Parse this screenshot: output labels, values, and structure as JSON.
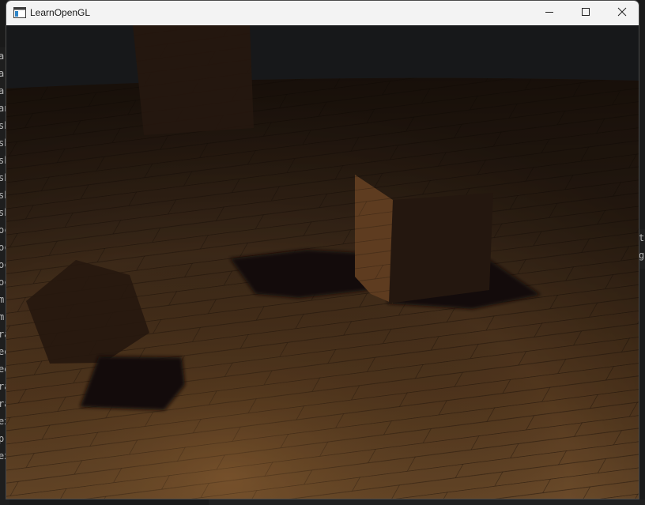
{
  "window": {
    "title": "LearnOpenGL",
    "icon": "app-window-icon",
    "controls": {
      "minimize": "minimize-icon",
      "maximize": "maximize-icon",
      "close": "close-icon"
    }
  },
  "scene": {
    "description_icon": "opengl-viewport",
    "floor_color": "#8a5a2c",
    "ambient_color": "#1b1c1e",
    "cube_color": "#2a1b12",
    "shadow_color": "#140c07"
  },
  "background_editor": {
    "left_glyphs": [
      "ar",
      "ar",
      "ar",
      "an",
      "sh",
      "sh",
      "sh",
      "sh",
      "sh",
      "sh",
      "oc",
      "oc",
      "oc",
      "oc",
      "m",
      "m",
      "ra",
      "ee",
      "ee",
      "ra",
      "ra",
      "ex",
      "p",
      "ex"
    ],
    "right_glyphs": [
      "t",
      "g"
    ]
  }
}
